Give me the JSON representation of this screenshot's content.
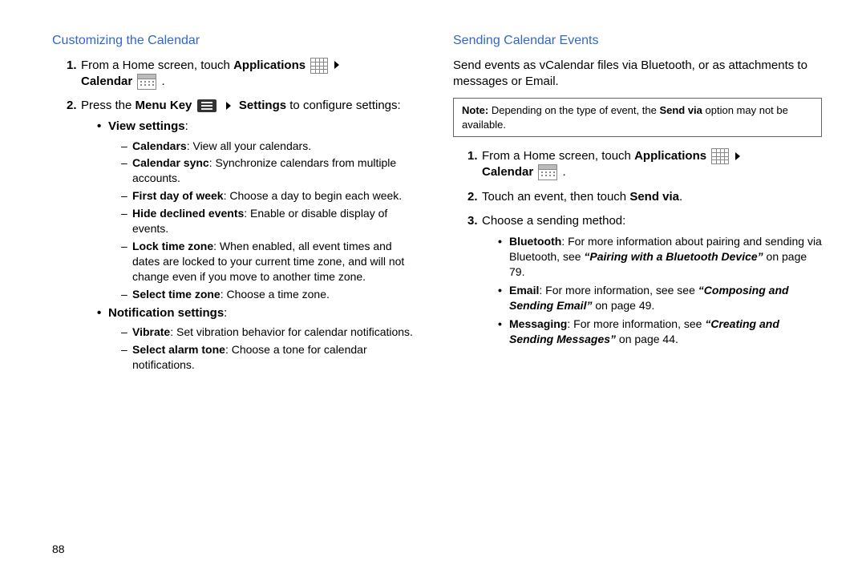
{
  "left": {
    "heading": "Customizing the Calendar",
    "step1_a": "From a Home screen, touch ",
    "step1_b": "Applications",
    "step1_c": "Calendar",
    "step2_a": "Press the ",
    "step2_b": "Menu Key",
    "step2_c": "Settings",
    "step2_d": " to configure settings:",
    "view_settings": "View settings",
    "vs1_b": "Calendars",
    "vs1_t": ": View all your calendars.",
    "vs2_b": "Calendar sync",
    "vs2_t": ": Synchronize calendars from multiple accounts.",
    "vs3_b": "First day of week",
    "vs3_t": ": Choose a day to begin each week.",
    "vs4_b": "Hide declined events",
    "vs4_t": ": Enable or disable display of events.",
    "vs5_b": "Lock time zone",
    "vs5_t": ": When enabled, all event times and dates are locked to your current time zone, and will not change even if you move to another time zone.",
    "vs6_b": "Select time zone",
    "vs6_t": ": Choose a time zone.",
    "notif_settings": "Notification settings",
    "ns1_b": "Vibrate",
    "ns1_t": ": Set vibration behavior for calendar notifications.",
    "ns2_b": "Select alarm tone",
    "ns2_t": ": Choose a tone for calendar notifications."
  },
  "right": {
    "heading": "Sending Calendar Events",
    "intro": "Send events as vCalendar files via Bluetooth, or as attachments to messages or Email.",
    "note_b": "Note:",
    "note_t1": " Depending on the type of event, the ",
    "note_t2": "Send via",
    "note_t3": " option may not be available.",
    "s1_a": "From a Home screen, touch ",
    "s1_b": "Applications",
    "s1_c": "Calendar",
    "s2_a": "Touch an event, then touch ",
    "s2_b": "Send via",
    "s3": "Choose a sending method:",
    "m1_b": "Bluetooth",
    "m1_t1": ": For more information about pairing and sending via Bluetooth, see ",
    "m1_it": "“Pairing with a Bluetooth Device”",
    "m1_t2": " on page 79.",
    "m2_b": "Email",
    "m2_t1": ": For more information, see see ",
    "m2_it": "“Composing and Sending Email”",
    "m2_t2": " on page 49.",
    "m3_b": "Messaging",
    "m3_t1": ": For more information, see ",
    "m3_it": "“Creating and Sending Messages”",
    "m3_t2": " on page 44."
  },
  "pagenum": "88"
}
